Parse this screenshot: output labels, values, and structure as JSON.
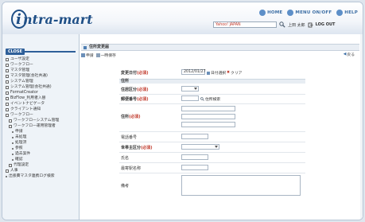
{
  "header": {
    "logo_text": "intra-mart",
    "nav": [
      {
        "label": "HOME"
      },
      {
        "label": "MENU ON/OFF"
      },
      {
        "label": "HELP"
      }
    ],
    "search_value": "Yahoo! JAPAN",
    "user_name": "上田 太郎",
    "logout_label": "LOG OUT"
  },
  "sidebar": {
    "close_label": "CLOSE",
    "items": [
      {
        "label": "ユーザ設定",
        "kind": "box"
      },
      {
        "label": "ワークフロー",
        "kind": "box"
      },
      {
        "label": "マスタ管理",
        "kind": "box"
      },
      {
        "label": "マスタ管理(会社共通)",
        "kind": "box"
      },
      {
        "label": "システム管理",
        "kind": "box"
      },
      {
        "label": "システム管理(会社共通)",
        "kind": "box"
      },
      {
        "label": "FormatCreator",
        "kind": "box"
      },
      {
        "label": "BizFlow_利用者入替",
        "kind": "box"
      },
      {
        "label": "イベントナビゲータ",
        "kind": "box"
      },
      {
        "label": "クライアント通知",
        "kind": "box"
      },
      {
        "label": "ワークフロー",
        "kind": "box"
      },
      {
        "label": "ワークフローシステム管理",
        "kind": "box",
        "indent": 1
      },
      {
        "label": "ワークフロー運用管理者",
        "kind": "box",
        "indent": 1
      },
      {
        "label": "申請",
        "kind": "dot",
        "indent": 2
      },
      {
        "label": "未処理",
        "kind": "dot",
        "indent": 2
      },
      {
        "label": "処理済",
        "kind": "dot",
        "indent": 2
      },
      {
        "label": "参照",
        "kind": "dot",
        "indent": 2
      },
      {
        "label": "過去案件",
        "kind": "dot",
        "indent": 2
      },
      {
        "label": "確認",
        "kind": "dot",
        "indent": 2
      },
      {
        "label": "代理設定",
        "kind": "box",
        "indent": 1
      },
      {
        "label": "人事",
        "kind": "box"
      },
      {
        "label": "出張費マスタ連携ログ検索",
        "kind": "dot"
      }
    ]
  },
  "content": {
    "title": "住所変更届",
    "toolbar": {
      "apply": "申請",
      "save": "一時保存",
      "back": "戻る"
    },
    "form": {
      "change_date_label": "変更日付",
      "required_mark": "(必須)",
      "change_date_value": "2012/01/27",
      "date_select_label": "日付選択",
      "clear_label": "クリア",
      "section_address": "住所",
      "housing_label": "住居区分",
      "postal_label": "郵便番号",
      "address_search_label": "住所検索",
      "address_label": "住所",
      "phone_label": "電話番号",
      "householder_label": "世帯主区分",
      "name_label": "氏名",
      "station_label": "最寄駅名称",
      "remarks_label": "備考"
    }
  }
}
